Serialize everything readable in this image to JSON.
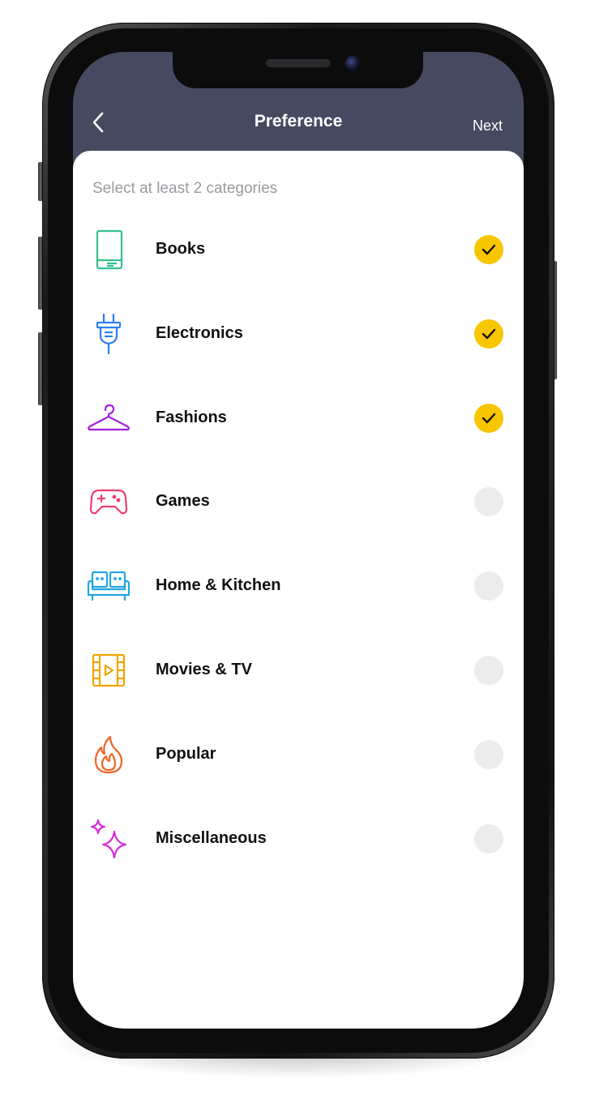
{
  "header": {
    "title": "Preference",
    "next_label": "Next"
  },
  "subtitle": "Select at least 2 categories",
  "colors": {
    "header_bg": "#454a60",
    "check_active": "#f7c600",
    "check_inactive": "#ececec"
  },
  "categories": [
    {
      "label": "Books",
      "icon": "book-icon",
      "color": "#33c18c",
      "selected": true
    },
    {
      "label": "Electronics",
      "icon": "plug-icon",
      "color": "#2d7ff0",
      "selected": true
    },
    {
      "label": "Fashions",
      "icon": "hanger-icon",
      "color": "#a21fe0",
      "selected": true
    },
    {
      "label": "Games",
      "icon": "gamepad-icon",
      "color": "#ef3d6a",
      "selected": false
    },
    {
      "label": "Home & Kitchen",
      "icon": "sofa-icon",
      "color": "#23a6de",
      "selected": false
    },
    {
      "label": "Movies & TV",
      "icon": "film-icon",
      "color": "#f2a500",
      "selected": false
    },
    {
      "label": "Popular",
      "icon": "flame-icon",
      "color": "#f06426",
      "selected": false
    },
    {
      "label": "Miscellaneous",
      "icon": "sparkles-icon",
      "color": "#d22fd8",
      "selected": false
    }
  ]
}
